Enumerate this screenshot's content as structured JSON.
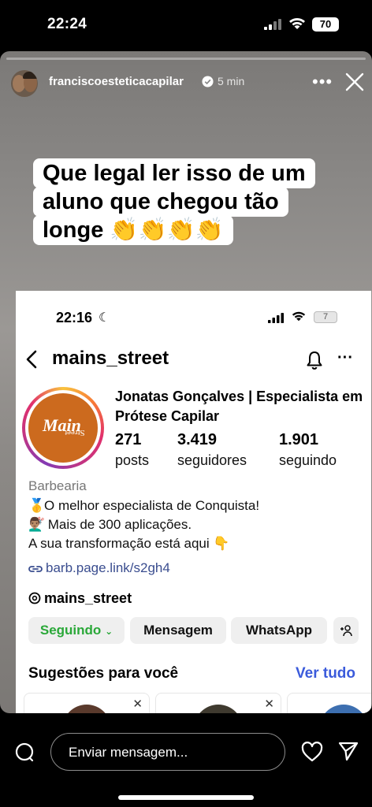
{
  "status_bar": {
    "time": "22:24",
    "battery": "70"
  },
  "story": {
    "progress_fraction": 0.0,
    "segments": 1,
    "username": "franciscoesteticacapilar",
    "time_ago": "5 min",
    "caption_lines": [
      "Que legal ler isso de um",
      "aluno que chegou tão",
      "longe 👏👏👏👏"
    ]
  },
  "screenshot": {
    "status": {
      "time": "22:16",
      "battery": "7"
    },
    "handle": "mains_street",
    "profile_logo": {
      "main": "Main",
      "street": "Street"
    },
    "name": "Jonatas Gonçalves | Especialista em Prótese Capilar",
    "stats": [
      {
        "value": "271",
        "label": "posts"
      },
      {
        "value": "3.419",
        "label": "seguidores"
      },
      {
        "value": "1.901",
        "label": "seguindo"
      }
    ],
    "category": "Barbearia",
    "bio": [
      {
        "emoji": "🥇",
        "text": "O melhor especialista de Conquista!"
      },
      {
        "emoji": "💇🏽‍♂️",
        "text": " Mais de 300 aplicações."
      },
      {
        "emoji": "",
        "text": "A sua transformação está aqui 👇"
      }
    ],
    "link": "barb.page.link/s2gh4",
    "threads_handle": "mains_street",
    "buttons": {
      "following": "Seguindo",
      "message": "Mensagem",
      "whatsapp": "WhatsApp"
    },
    "suggestions_title": "Sugestões para você",
    "see_all": "Ver tudo",
    "colors": {
      "accent_green": "#2aa839",
      "link_blue": "#3b5bdb",
      "logo_orange": "#cc6a1e"
    }
  },
  "bottom_bar": {
    "message_placeholder": "Enviar mensagem..."
  }
}
